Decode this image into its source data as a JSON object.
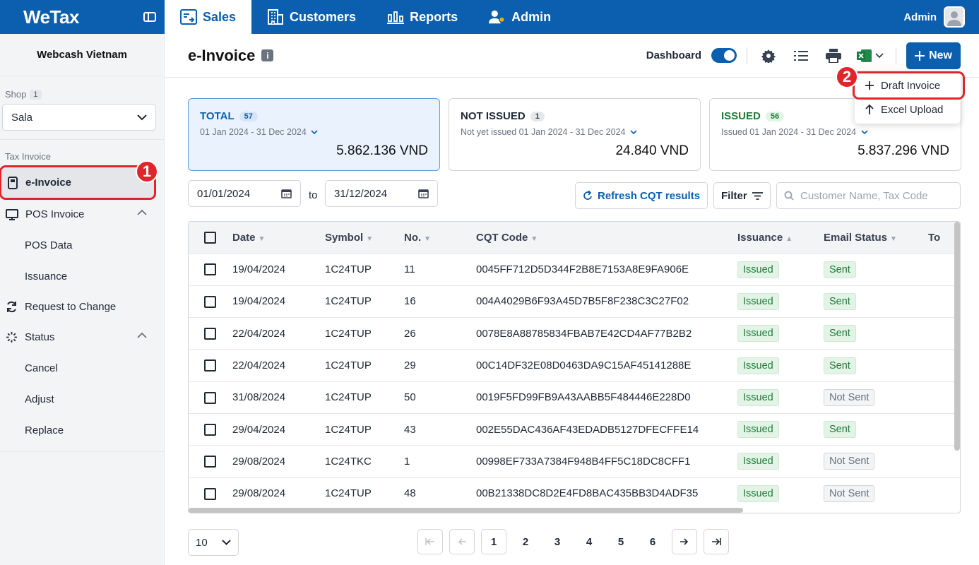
{
  "app": {
    "logo": "WeTax",
    "user": "Admin"
  },
  "nav": [
    {
      "label": "Sales",
      "active": true,
      "icon": "sales-icon"
    },
    {
      "label": "Customers",
      "active": false,
      "icon": "building-icon"
    },
    {
      "label": "Reports",
      "active": false,
      "icon": "bar-chart-icon"
    },
    {
      "label": "Admin",
      "active": false,
      "icon": "user-gear-icon"
    }
  ],
  "sidebar": {
    "company": "Webcash Vietnam",
    "shop_label": "Shop",
    "shop_count": "1",
    "shop_value": "Sala",
    "section_label": "Tax Invoice",
    "einvoice": "e-Invoice",
    "pos_invoice": "POS Invoice",
    "pos_data": "POS Data",
    "issuance": "Issuance",
    "request_change": "Request to Change",
    "status": "Status",
    "cancel": "Cancel",
    "adjust": "Adjust",
    "replace": "Replace"
  },
  "header": {
    "title": "e-Invoice",
    "info": "i",
    "dashboard": "Dashboard",
    "new_label": "New"
  },
  "dropdown": {
    "draft": "Draft Invoice",
    "excel": "Excel Upload"
  },
  "steps": {
    "one": "1",
    "two": "2"
  },
  "cards": [
    {
      "title": "TOTAL",
      "count": "57",
      "sub": "01 Jan 2024 - 31 Dec 2024",
      "amount": "5.862.136 VND"
    },
    {
      "title": "NOT ISSUED",
      "count": "1",
      "sub": "Not yet issued 01 Jan 2024 - 31 Dec 2024",
      "amount": "24.840 VND"
    },
    {
      "title": "ISSUED",
      "count": "56",
      "sub": "Issued 01 Jan 2024 - 31 Dec 2024",
      "amount": "5.837.296 VND"
    }
  ],
  "filters": {
    "from": "01/01/2024",
    "to_label": "to",
    "to": "31/12/2024",
    "refresh": "Refresh CQT results",
    "filter": "Filter",
    "search_placeholder": "Customer Name, Tax Code"
  },
  "table": {
    "columns": [
      "Date",
      "Symbol",
      "No.",
      "CQT Code",
      "Issuance",
      "Email Status",
      "To"
    ],
    "rows": [
      {
        "date": "19/04/2024",
        "symbol": "1C24TUP",
        "no": "11",
        "cqt": "0045FF712D5D344F2B8E7153A8E9FA906E",
        "issuance": "Issued",
        "email": "Sent"
      },
      {
        "date": "19/04/2024",
        "symbol": "1C24TUP",
        "no": "16",
        "cqt": "004A4029B6F93A45D7B5F8F238C3C27F02",
        "issuance": "Issued",
        "email": "Sent"
      },
      {
        "date": "22/04/2024",
        "symbol": "1C24TUP",
        "no": "26",
        "cqt": "0078E8A88785834FBAB7E42CD4AF77B2B2",
        "issuance": "Issued",
        "email": "Sent"
      },
      {
        "date": "22/04/2024",
        "symbol": "1C24TUP",
        "no": "29",
        "cqt": "00C14DF32E08D0463DA9C15AF45141288E",
        "issuance": "Issued",
        "email": "Sent"
      },
      {
        "date": "31/08/2024",
        "symbol": "1C24TUP",
        "no": "50",
        "cqt": "0019F5FD99FB9A43AABB5F484446E228D0",
        "issuance": "Issued",
        "email": "Not Sent"
      },
      {
        "date": "29/04/2024",
        "symbol": "1C24TUP",
        "no": "43",
        "cqt": "002E55DAC436AF43EDADB5127DFECFFE14",
        "issuance": "Issued",
        "email": "Sent"
      },
      {
        "date": "29/08/2024",
        "symbol": "1C24TKC",
        "no": "1",
        "cqt": "00998EF733A7384F948B4FF5C18DC8CFF1",
        "issuance": "Issued",
        "email": "Not Sent"
      },
      {
        "date": "29/08/2024",
        "symbol": "1C24TUP",
        "no": "48",
        "cqt": "00B21338DC8D2E4FD8BAC435BB3D4ADF35",
        "issuance": "Issued",
        "email": "Not Sent"
      }
    ]
  },
  "pagination": {
    "page_size": "10",
    "pages": [
      "1",
      "2",
      "3",
      "4",
      "5",
      "6"
    ],
    "current": "1"
  },
  "colors": {
    "brand": "#0b5fae",
    "highlight": "#e0262b",
    "issued": "#1e7a36"
  }
}
